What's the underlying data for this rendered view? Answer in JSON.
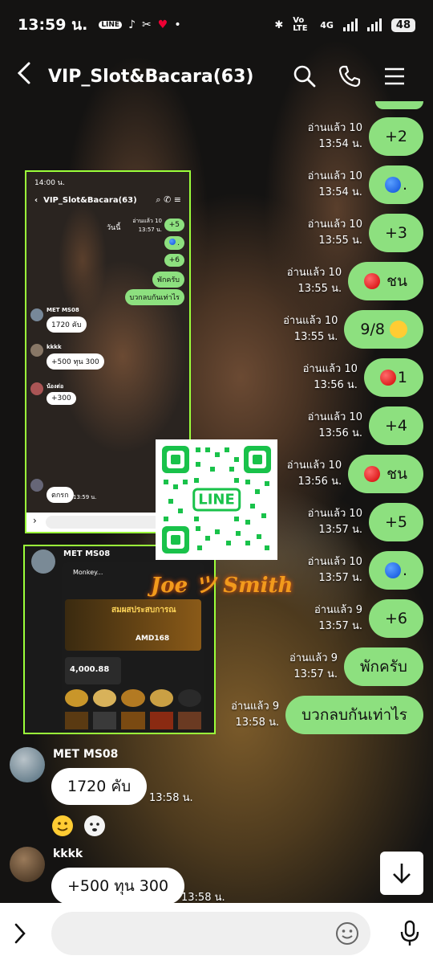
{
  "status_bar": {
    "time": "13:59 น.",
    "network": "4G",
    "volte": "Vo LTE",
    "battery": "48"
  },
  "header": {
    "title": "VIP_Slot&Bacara(63)"
  },
  "outgoing_messages": [
    {
      "read": "อ่านแล้ว 10",
      "time": "13:54 น.",
      "text": "+2"
    },
    {
      "read": "อ่านแล้ว 10",
      "time": "13:54 น.",
      "text": ".",
      "emoji": "blue-circle"
    },
    {
      "read": "อ่านแล้ว 10",
      "time": "13:55 น.",
      "text": "+3"
    },
    {
      "read": "อ่านแล้ว 10",
      "time": "13:55 น.",
      "text": "ชน",
      "emoji": "red-circle"
    },
    {
      "read": "อ่านแล้ว 10",
      "time": "13:55 น.",
      "text": "9/8",
      "emoji": "laughing-face"
    },
    {
      "read": "อ่านแล้ว 10",
      "time": "13:56 น.",
      "text": "1",
      "emoji": "red-circle"
    },
    {
      "read": "อ่านแล้ว 10",
      "time": "13:56 น.",
      "text": "+4"
    },
    {
      "read": "อ่านแล้ว 10",
      "time": "13:56 น.",
      "text": "ชน",
      "emoji": "red-circle"
    },
    {
      "read": "อ่านแล้ว 10",
      "time": "13:57 น.",
      "text": "+5"
    },
    {
      "read": "อ่านแล้ว 10",
      "time": "13:57 น.",
      "text": ".",
      "emoji": "blue-circle"
    },
    {
      "read": "อ่านแล้ว 9",
      "time": "13:57 น.",
      "text": "+6"
    },
    {
      "read": "อ่านแล้ว 9",
      "time": "13:57 น.",
      "text": "พักครับ"
    },
    {
      "read": "อ่านแล้ว 9",
      "time": "13:58 น.",
      "text": "บวกลบกันเท่าไร"
    }
  ],
  "incoming_messages": [
    {
      "sender": "MET MS08",
      "text": "1720 คับ",
      "time": "13:58 น."
    },
    {
      "sender": "kkkk",
      "text": "+500 ทุน 300",
      "time": "13:58 น."
    }
  ],
  "screenshot_1": {
    "time": "14:00 น.",
    "title": "VIP_Slot&Bacara(63)",
    "today": "วันนี้",
    "read_a": "อ่านแล้ว 10",
    "time_a": "13:57 น.",
    "msgs": [
      "+5",
      ".",
      "+6",
      "พักครับ",
      "บวกลบกันเท่าไร"
    ],
    "sender_1": "MET MS08",
    "msg_1": "1720 คับ",
    "sender_2": "kkkk",
    "msg_2": "+500 ทุน 300",
    "sender_3": "น้องต่อ",
    "msg_3": "+300",
    "msg_4": "ตกรก",
    "time_4": "13:59 น."
  },
  "screenshot_2": {
    "sender": "MET MS08",
    "app_name": "Monkey...",
    "banner_text": "สมผสประสบการณ",
    "banner_brand": "AMD168",
    "balance": "4,000.88"
  },
  "qr_label": "LINE",
  "logo_text": "Joe ツ Smith",
  "input": {
    "placeholder": ""
  },
  "colors": {
    "outgoing_bubble": "#8de07f",
    "incoming_bubble": "#ffffff",
    "highlight_border": "#9bff3a"
  }
}
